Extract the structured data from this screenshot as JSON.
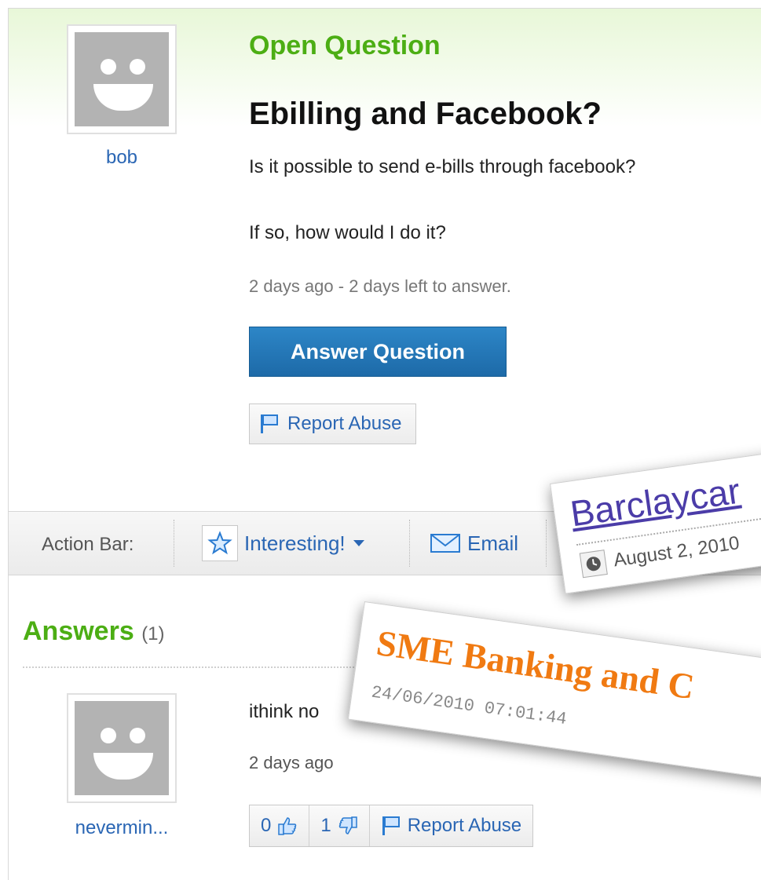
{
  "question": {
    "status_label": "Open Question",
    "title": "Ebilling and Facebook?",
    "asker": "bob",
    "body_line1": "Is it possible to send e-bills through facebook?",
    "body_line2": "If so, how would I do it?",
    "meta": "2 days ago - 2 days left to answer.",
    "answer_button": "Answer Question",
    "report_abuse": "Report Abuse"
  },
  "action_bar": {
    "label": "Action Bar:",
    "interesting": "Interesting!",
    "email": "Email"
  },
  "answers": {
    "heading": "Answers",
    "count": "(1)",
    "items": [
      {
        "author": "nevermin...",
        "text": "ithink no",
        "time": "2 days ago",
        "thumbs_up": "0",
        "thumbs_down": "1",
        "report_abuse": "Report Abuse"
      }
    ]
  },
  "overlays": {
    "card1_title": "Barclaycar",
    "card1_date": "August 2, 2010",
    "card2_title": "SME Banking and C",
    "card2_date": "24/06/2010 07:01:44"
  },
  "icons": {
    "flag": "flag-icon",
    "star": "star-icon",
    "dropdown": "caret-down-icon",
    "email": "envelope-icon",
    "thumbs_up": "thumbs-up-icon",
    "thumbs_down": "thumbs-down-icon",
    "clock": "clock-icon"
  },
  "colors": {
    "accent_green": "#4cae14",
    "link_blue": "#2a66b4",
    "button_blue": "#1d6aa8",
    "orange": "#f07a12"
  }
}
